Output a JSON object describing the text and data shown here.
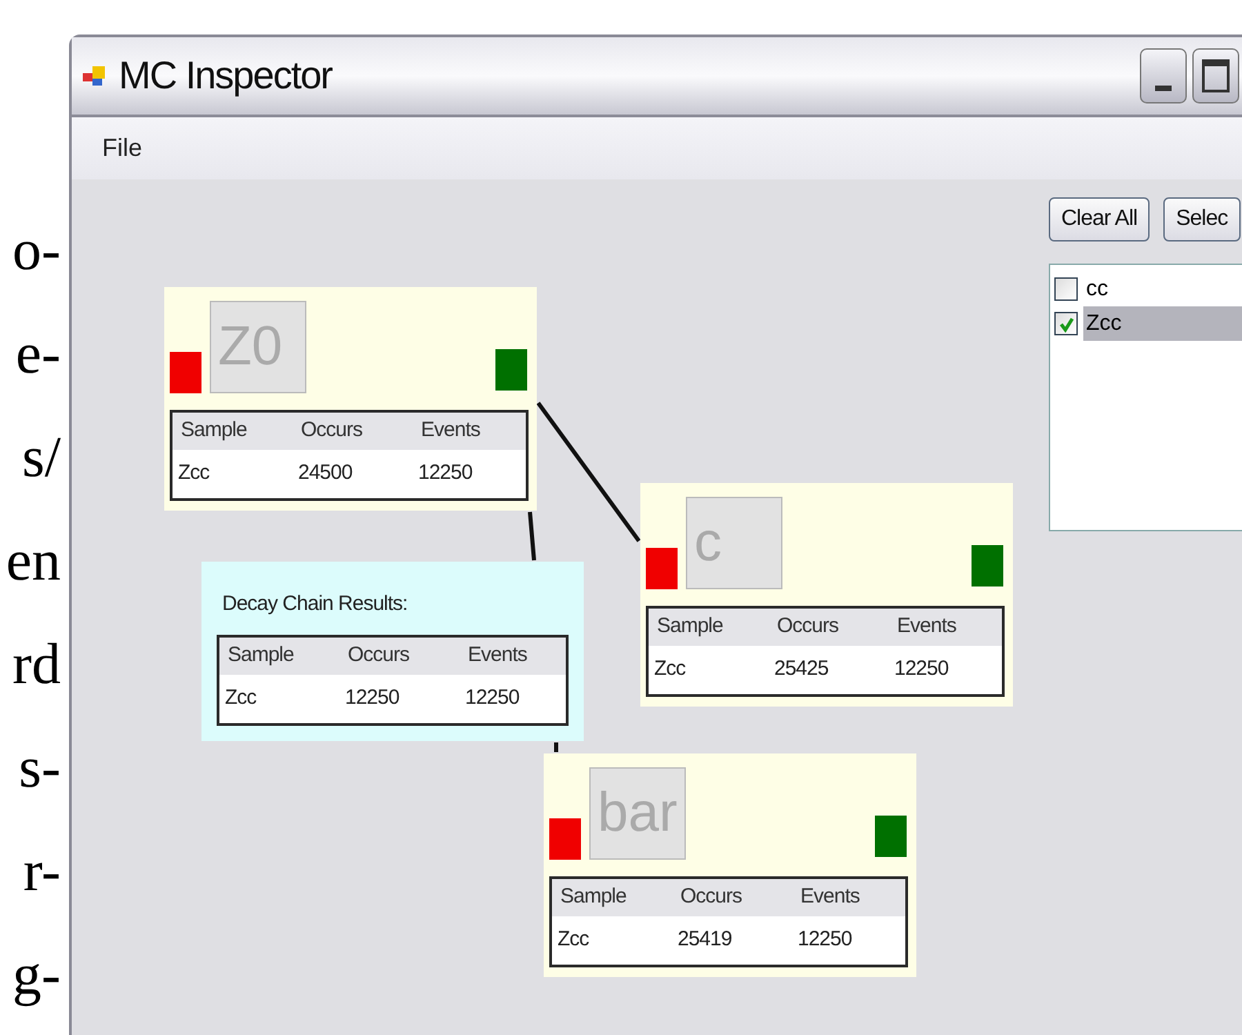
{
  "page_text": [
    "o-",
    "e-",
    "s/",
    "en",
    "rd",
    "s-",
    "r-",
    "g-"
  ],
  "window": {
    "title": "MC Inspector"
  },
  "menu": [
    "File"
  ],
  "nodes": [
    {
      "label": "Z0",
      "table": {
        "columns": [
          "Sample",
          "Occurs",
          "Events"
        ],
        "rows": [
          [
            "Zcc",
            "24500",
            "12250"
          ]
        ]
      }
    },
    {
      "label": "c",
      "table": {
        "columns": [
          "Sample",
          "Occurs",
          "Events"
        ],
        "rows": [
          [
            "Zcc",
            "25425",
            "12250"
          ]
        ]
      }
    },
    {
      "label": "bar",
      "table": {
        "columns": [
          "Sample",
          "Occurs",
          "Events"
        ],
        "rows": [
          [
            "Zcc",
            "25419",
            "12250"
          ]
        ]
      }
    }
  ],
  "results": {
    "title": "Decay Chain Results:",
    "table": {
      "columns": [
        "Sample",
        "Occurs",
        "Events"
      ],
      "rows": [
        [
          "Zcc",
          "12250",
          "12250"
        ]
      ]
    }
  },
  "buttons": [
    "Clear All",
    "Selec"
  ],
  "samples": [
    {
      "label": "cc",
      "checked": false,
      "selected": false
    },
    {
      "label": "Zcc",
      "checked": true,
      "selected": true
    }
  ]
}
